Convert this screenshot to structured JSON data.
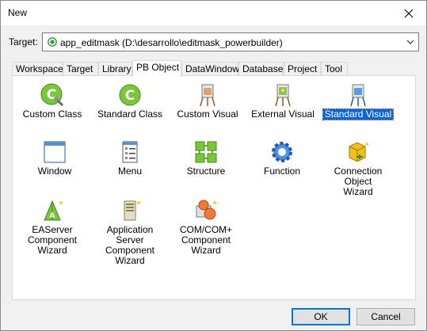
{
  "window": {
    "title": "New"
  },
  "target": {
    "label": "Target:",
    "value": "app_editmask (D:\\desarrollo\\editmask_powerbuilder)"
  },
  "tabs": [
    {
      "label": "Workspace",
      "active": false
    },
    {
      "label": "Target",
      "active": false
    },
    {
      "label": "Library",
      "active": false
    },
    {
      "label": "PB Object",
      "active": true
    },
    {
      "label": "DataWindow",
      "active": false
    },
    {
      "label": "Database",
      "active": false
    },
    {
      "label": "Project",
      "active": false
    },
    {
      "label": "Tool",
      "active": false
    }
  ],
  "items": [
    {
      "label": "Custom Class",
      "icon": "custom-class-icon",
      "selected": false
    },
    {
      "label": "Standard Class",
      "icon": "standard-class-icon",
      "selected": false
    },
    {
      "label": "Custom Visual",
      "icon": "custom-visual-icon",
      "selected": false
    },
    {
      "label": "External Visual",
      "icon": "external-visual-icon",
      "selected": false
    },
    {
      "label": "Standard Visual",
      "icon": "standard-visual-icon",
      "selected": true
    },
    {
      "label": "Window",
      "icon": "window-icon",
      "selected": false
    },
    {
      "label": "Menu",
      "icon": "menu-icon",
      "selected": false
    },
    {
      "label": "Structure",
      "icon": "structure-icon",
      "selected": false
    },
    {
      "label": "Function",
      "icon": "function-icon",
      "selected": false
    },
    {
      "label": "Connection Object Wizard",
      "label_lines": [
        "Connection Object",
        "Wizard"
      ],
      "icon": "connection-wizard-icon",
      "selected": false
    },
    {
      "label": "EAServer Component Wizard",
      "label_lines": [
        "EAServer",
        "Component Wizard"
      ],
      "icon": "easerver-wizard-icon",
      "selected": false
    },
    {
      "label": "Application Server Component Wizard",
      "label_lines": [
        "Application Server",
        "Component Wizard"
      ],
      "icon": "app-server-wizard-icon",
      "selected": false
    },
    {
      "label": "COM/COM+ Component Wizard",
      "label_lines": [
        "COM/COM+",
        "Component Wizard"
      ],
      "icon": "com-wizard-icon",
      "selected": false
    }
  ],
  "buttons": {
    "ok": "OK",
    "cancel": "Cancel"
  },
  "colors": {
    "selection": "#0a64d8",
    "accent_green": "#6cbf2a",
    "default_button_border": "#0078d7"
  }
}
